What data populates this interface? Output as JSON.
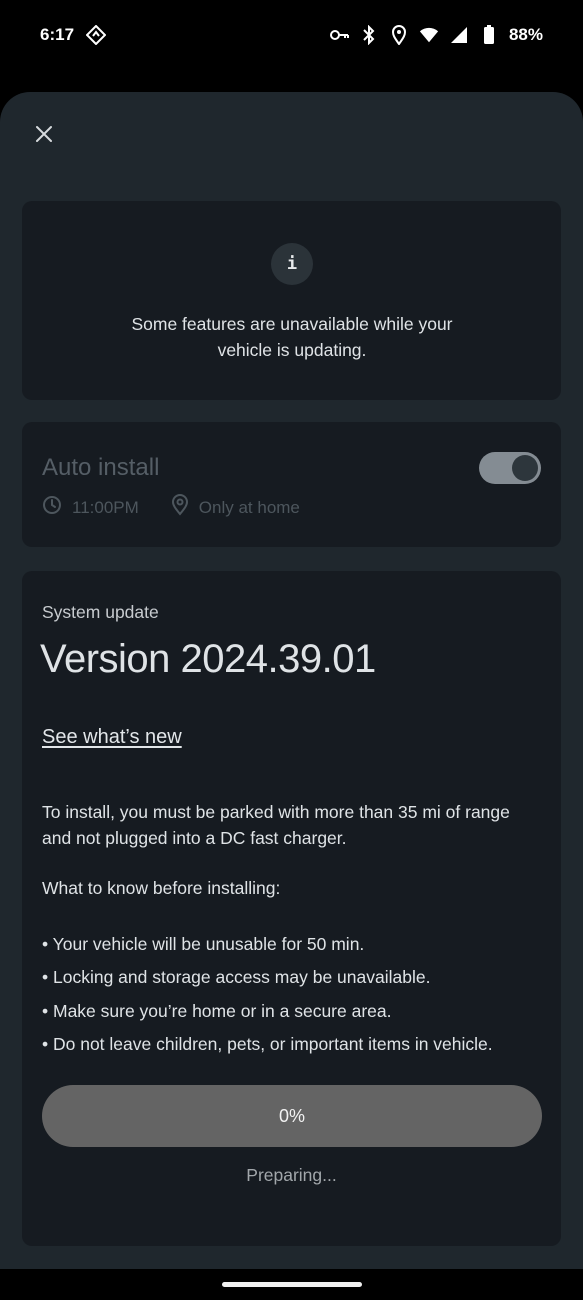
{
  "status_bar": {
    "time": "6:17",
    "battery": "88%",
    "icons": [
      "nav-diamond-icon",
      "key-icon",
      "bluetooth-icon",
      "location-icon",
      "wifi-icon",
      "signal-icon",
      "battery-icon"
    ]
  },
  "sheet": {
    "close_icon": "close-icon"
  },
  "info": {
    "icon_glyph": "i",
    "message": "Some features are unavailable while your vehicle is updating."
  },
  "auto_install": {
    "title": "Auto install",
    "time": "11:00PM",
    "location": "Only at home",
    "enabled": true
  },
  "update": {
    "label": "System update",
    "version": "Version 2024.39.01",
    "whats_new_link": "See what’s new",
    "install_requirements": "To install, you must be parked with more than 35 mi of range and not plugged into a DC fast charger.",
    "know_title": "What to know before installing:",
    "bullets": [
      "• Your vehicle will be unusable for 50 min.",
      "• Locking and storage access may be unavailable.",
      "• Make sure you’re home or in a secure area.",
      "• Do not leave children, pets, or important items in vehicle."
    ],
    "progress_label": "0%",
    "progress_value": 0,
    "status": "Preparing..."
  },
  "colors": {
    "sheet_bg": "#1f272d",
    "card_bg": "#161b21",
    "progress_bg": "#646464",
    "toggle_track": "#848c93"
  }
}
